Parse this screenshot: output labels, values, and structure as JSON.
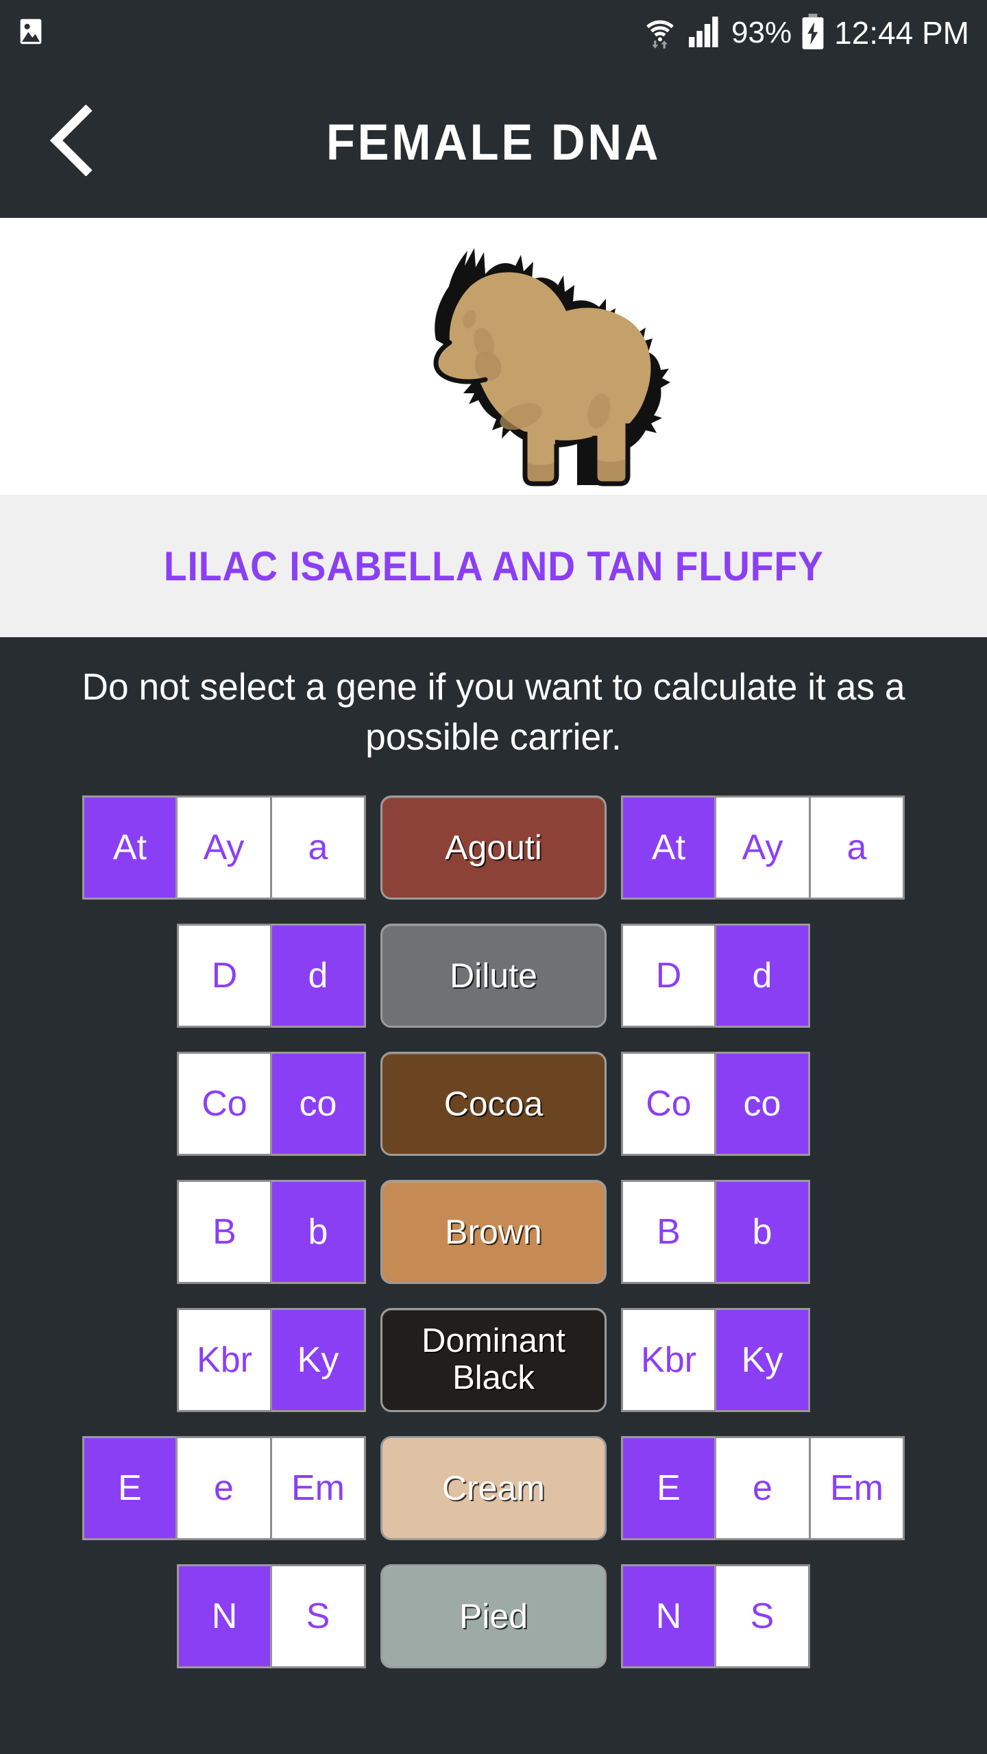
{
  "statusbar": {
    "gallery_icon": "image-icon",
    "wifi_icon": "wifi-icon",
    "signal_icon": "signal-bars-icon",
    "battery_percent": "93%",
    "battery_icon": "battery-charging-icon",
    "time": "12:44 PM"
  },
  "header": {
    "back_icon": "chevron-left-icon",
    "title": "FEMALE DNA"
  },
  "dog": {
    "illustration": "fluffy-dog-illustration",
    "body_color": "#C4A06A",
    "shade_color": "#B38E5D",
    "outline_color": "#000000"
  },
  "phenotype": {
    "label": "LILAC ISABELLA AND TAN FLUFFY",
    "color": "#8B3FF5",
    "bar_background": "#F0F0F0"
  },
  "main": {
    "instruction": "Do not select a gene if you want to calculate it as a possible carrier.",
    "selected_color": "#8B3FF5",
    "unselected_color": "#FFFFFF",
    "background": "#282D31"
  },
  "genes": [
    {
      "name": "Agouti",
      "button_color": "#8C4236",
      "left": [
        {
          "label": "At",
          "selected": true
        },
        {
          "label": "Ay",
          "selected": false
        },
        {
          "label": "a",
          "selected": false
        }
      ],
      "right": [
        {
          "label": "At",
          "selected": true
        },
        {
          "label": "Ay",
          "selected": false
        },
        {
          "label": "a",
          "selected": false
        }
      ]
    },
    {
      "name": "Dilute",
      "button_color": "#6E7274",
      "left": [
        {
          "label": "D",
          "selected": false
        },
        {
          "label": "d",
          "selected": true
        }
      ],
      "right": [
        {
          "label": "D",
          "selected": false
        },
        {
          "label": "d",
          "selected": true
        }
      ]
    },
    {
      "name": "Cocoa",
      "button_color": "#6B4522",
      "left": [
        {
          "label": "Co",
          "selected": false
        },
        {
          "label": "co",
          "selected": true
        }
      ],
      "right": [
        {
          "label": "Co",
          "selected": false
        },
        {
          "label": "co",
          "selected": true
        }
      ]
    },
    {
      "name": "Brown",
      "button_color": "#C68B55",
      "left": [
        {
          "label": "B",
          "selected": false
        },
        {
          "label": "b",
          "selected": true
        }
      ],
      "right": [
        {
          "label": "B",
          "selected": false
        },
        {
          "label": "b",
          "selected": true
        }
      ]
    },
    {
      "name": "Dominant Black",
      "button_color": "#201F1D",
      "left": [
        {
          "label": "Kbr",
          "selected": false
        },
        {
          "label": "Ky",
          "selected": true
        }
      ],
      "right": [
        {
          "label": "Kbr",
          "selected": false
        },
        {
          "label": "Ky",
          "selected": true
        }
      ]
    },
    {
      "name": "Cream",
      "button_color": "#DFC1A4",
      "left": [
        {
          "label": "E",
          "selected": true
        },
        {
          "label": "e",
          "selected": false
        },
        {
          "label": "Em",
          "selected": false
        }
      ],
      "right": [
        {
          "label": "E",
          "selected": true
        },
        {
          "label": "e",
          "selected": false
        },
        {
          "label": "Em",
          "selected": false
        }
      ]
    },
    {
      "name": "Pied",
      "button_color": "#9DAAA5",
      "left": [
        {
          "label": "N",
          "selected": true
        },
        {
          "label": "S",
          "selected": false
        }
      ],
      "right": [
        {
          "label": "N",
          "selected": true
        },
        {
          "label": "S",
          "selected": false
        }
      ]
    }
  ]
}
